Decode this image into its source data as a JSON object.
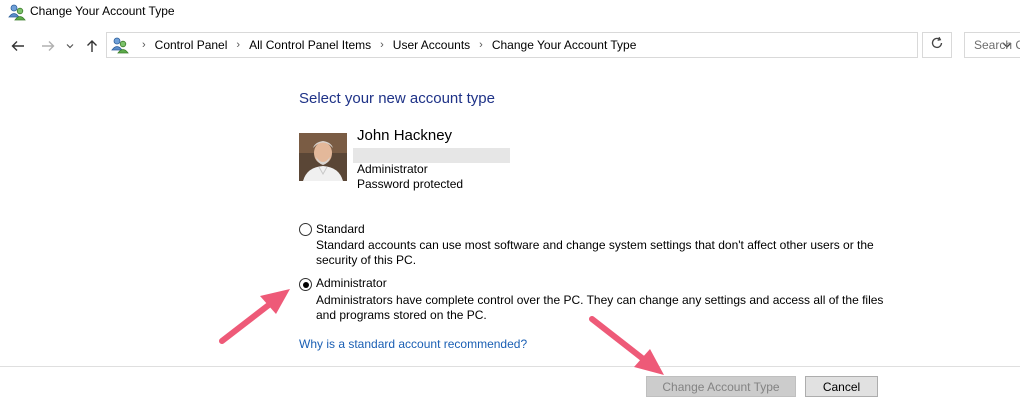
{
  "window": {
    "title": "Change Your Account Type"
  },
  "address_bar": {
    "breadcrumbs": [
      "Control Panel",
      "All Control Panel Items",
      "User Accounts",
      "Change Your Account Type"
    ],
    "search_placeholder": "Search C"
  },
  "icons": {
    "title": "user-accounts-icon",
    "back": "arrow-left-icon",
    "forward": "arrow-right-icon",
    "recent": "chevron-down-icon",
    "up": "arrow-up-icon",
    "breadcrumb": "user-accounts-icon",
    "dropdown": "chevron-down-icon",
    "refresh": "refresh-icon"
  },
  "main": {
    "heading": "Select your new account type",
    "account": {
      "name": "John Hackney",
      "type": "Administrator",
      "status": "Password protected"
    },
    "options": [
      {
        "label": "Standard",
        "description": "Standard accounts can use most software and change system settings that don't affect other users or the security of this PC.",
        "selected": false
      },
      {
        "label": "Administrator",
        "description": "Administrators have complete control over the PC. They can change any settings and access all of the files and programs stored on the PC.",
        "selected": true
      }
    ],
    "help_link": "Why is a standard account recommended?"
  },
  "buttons": {
    "change": "Change Account Type",
    "change_enabled": false,
    "cancel": "Cancel"
  },
  "colors": {
    "heading": "#1e3287",
    "link": "#1a5fb4",
    "annotation_arrow": "#ee5a78",
    "disabled_button": "#cccccc"
  }
}
